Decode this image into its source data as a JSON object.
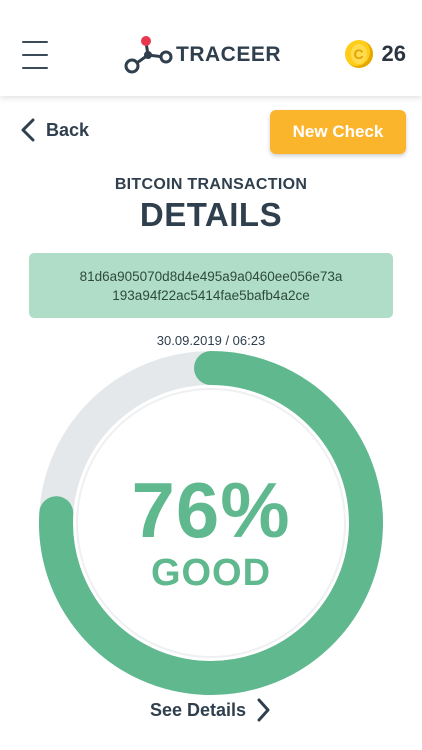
{
  "header": {
    "brand": "TRACEER",
    "coin_count": "26",
    "coin_glyph": "C",
    "icons": {
      "menu": "hamburger-menu-icon",
      "logo": "traceer-logo-icon",
      "coin": "coin-icon"
    }
  },
  "nav": {
    "back_label": "Back",
    "new_check_label": "New Check"
  },
  "transaction": {
    "subtitle": "BITCOIN TRANSACTION",
    "title": "DETAILS",
    "hash_line1": "81d6a905070d8d4e495a9a0460ee056e73a",
    "hash_line2": "193a94f22ac5414fae5bafb4a2ce",
    "timestamp": "30.09.2019 / 06:23"
  },
  "score": {
    "value": 76,
    "display": "76%",
    "rating": "GOOD"
  },
  "footer": {
    "see_details_label": "See Details"
  },
  "colors": {
    "accent_green": "#5fb88e",
    "hash_bg": "#b0ddc7",
    "track_gray": "#e5e8ea",
    "button_orange": "#fbb52d",
    "text_dark": "#2f3f4d"
  }
}
